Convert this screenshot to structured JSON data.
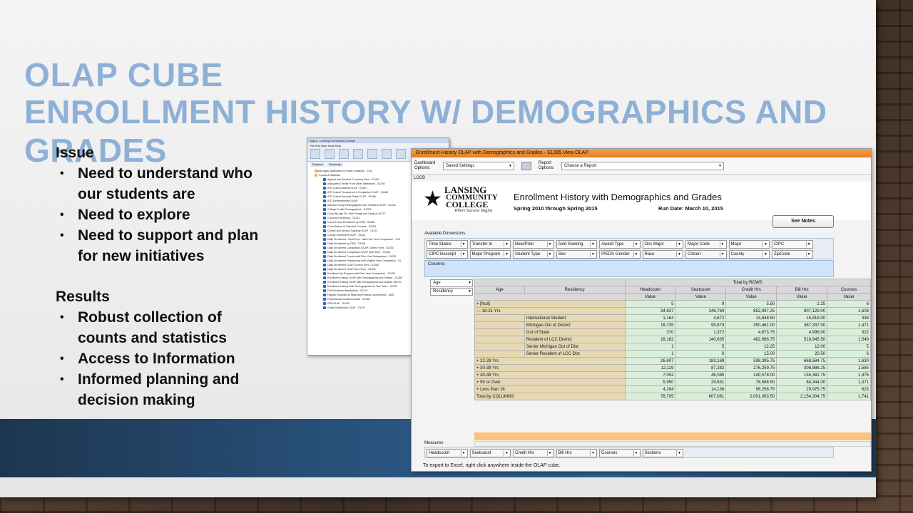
{
  "slide": {
    "title_line1": "OLAP CUBE",
    "title_line2": "ENROLLMENT HISTORY W/ DEMOGRAPHICS AND GRADES",
    "issue_head": "Issue",
    "issue_items": [
      "Need to understand who our students are",
      "Need to explore",
      "Need to support and plan for new initiatives"
    ],
    "results_head": "Results",
    "results_items": [
      "Robust collection of counts and statistics",
      "Access to Information",
      "Informed planning and decision making"
    ]
  },
  "argos": {
    "title": "Argos - Lansing Community College",
    "menu": "File  Edit  View  Tools  Help",
    "tabs": [
      "Explorer",
      "Shortcuts"
    ],
    "path": "Argos.Argos DataBlocks & Folder Locations - 1412",
    "tree": [
      "Counts & Statistics",
      "Applied and Enrolled Counts by Term - S1464",
      "Articulated Credits From Other Institutions - S1294",
      "ATD Cohort Awards OLAP - S1487",
      "ATD Cohort Persistence & Completion OLAP - S1483",
      "ATD Cohort Success Rates OLAP - S1486",
      "ATD Developmental OLAP",
      "Attribute Group Demographics and Transfers OLAP - S1432",
      "College Profile Demographics - S1253",
      "Count By Age For Term Range and Campus S1177",
      "Count by Residency - S1211",
      "Count Future Enrollment by CRN - S1365",
      "Count Takers of Selected Courses - S1284",
      "Course and Section Capacity OLAP - S1471",
      "Course Enrollment OLAP - S1114",
      "Daily Enrollment - Next Term - with Prior Year Comparison - S12",
      "Daily Enrollment by CRN - S1294",
      "Daily Enrollment Comparison OLAP Current Term - S1335",
      "Daily Enrollment Comparison OLAP Next Term - S1335",
      "Daily Enrollment Counts with Prior Year Comparison - S1252",
      "Daily Enrollment Headcounts with Multiple Year Comparison - S1",
      "Daily Enrollment OLAP Current Term - S1284",
      "Daily Enrollment OLAP Next Term - S1284",
      "Enrollment by Program with Prior Year Comparison - S1239",
      "Enrollment History OLAP with Demographics and Grades - S1285",
      "Enrollment History OLAP with Demographics and Grades with Ex",
      "Enrollment History With Demographics for Two Years - S1332",
      "Fall Enrollment Breakdown - S1474",
      "Figures Reported to State and Federal Government - 1405",
      "Financial Aid Student Counts - S1084",
      "GPA OLAP - S1282",
      "Grade Distribution OLAP - S1472"
    ]
  },
  "olap": {
    "window_title": "Enrollment History OLAP with Demographics and Grades - S1285.View OLAP",
    "dashboard_label": "Dashboard Options:",
    "dashboard_value": "Saved Settings",
    "report_label": "Report Options:",
    "report_value": "Choose a Report",
    "lccb": "LCCB",
    "logo": {
      "line1": "LANSING",
      "line2": "COMMUNITY",
      "line3": "COLLEGE",
      "tagline": "Where Success Begins"
    },
    "report_title": "Enrollment History with Demographics and Grades",
    "report_subtitle": "Spring 2010 through Spring 2015",
    "run_date": "Run Date: March 10, 2015",
    "see_notes": "See Notes",
    "available_dimensions": "Available Dimensions",
    "dims_row1": [
      "Time Status",
      "Transfer In",
      "New/Prior",
      "Avid Seeking",
      "Award Type",
      "Occ Major",
      "Major Code",
      "Major",
      "CIPC"
    ],
    "dims_row2": [
      "CIPC Descript",
      "Major Program",
      "Student Type",
      "Sex",
      "IPEDS Gender",
      "Race",
      "Citizen",
      "County",
      "ZipCode"
    ],
    "columns_label": "Columns",
    "row_dims": [
      "Age",
      "Residency"
    ],
    "grid": {
      "total_by_rows": "Total by ROWS",
      "age_hdr": "Age",
      "residency_hdr": "Residency",
      "measures": [
        "Headcount",
        "Seatcount",
        "Credit Hrs",
        "Bill Hrs",
        "Courses"
      ],
      "value_label": "Value",
      "rows": [
        {
          "age": "+ [Null]",
          "res": "",
          "vals": [
            "5",
            "9",
            "5.50",
            "2.25",
            "6"
          ]
        },
        {
          "age": "— 18-21 Yrs",
          "res": "",
          "vals": [
            "34,637",
            "246,769",
            "852,997.25",
            "907,129.00",
            "1,608"
          ]
        },
        {
          "age": "",
          "res": "International Student",
          "vals": [
            "1,164",
            "4,672",
            "14,848.50",
            "15,818.00",
            "438"
          ]
        },
        {
          "age": "",
          "res": "Michigan Out of District",
          "vals": [
            "16,735",
            "99,879",
            "350,461.00",
            "367,337.00",
            "1,471"
          ]
        },
        {
          "age": "",
          "res": "Out of State",
          "vals": [
            "370",
            "1,372",
            "4,673.75",
            "4,996.00",
            "322"
          ]
        },
        {
          "age": "",
          "res": "Resident of LCC District",
          "vals": [
            "18,182",
            "140,835",
            "482,986.75",
            "518,945.50",
            "1,549"
          ]
        },
        {
          "age": "",
          "res": "Senior Michigan Out of Dist",
          "vals": [
            "1",
            "5",
            "12.25",
            "12.00",
            "5"
          ]
        },
        {
          "age": "",
          "res": "Senior Resident of LCC Dist",
          "vals": [
            "1",
            "6",
            "15.00",
            "20.50",
            "6"
          ]
        },
        {
          "age": "+ 22-29 Yrs",
          "res": "",
          "vals": [
            "26,607",
            "183,169",
            "598,395.75",
            "668,584.75",
            "1,630"
          ]
        },
        {
          "age": "+ 30-39 Yrs",
          "res": "",
          "vals": [
            "12,119",
            "87,282",
            "276,259.75",
            "308,886.25",
            "1,585"
          ]
        },
        {
          "age": "+ 40-49 Yrs",
          "res": "",
          "vals": [
            "7,052",
            "46,085",
            "140,578.00",
            "155,382.75",
            "1,476"
          ]
        },
        {
          "age": "+ 50 or Over",
          "res": "",
          "vals": [
            "5,950",
            "29,631",
            "76,568.50",
            "84,344.00",
            "1,371"
          ]
        },
        {
          "age": "+ Less than 18",
          "res": "",
          "vals": [
            "4,284",
            "14,136",
            "56,258.75",
            "29,975.75",
            "623"
          ]
        },
        {
          "age": "Total by COLUMNS",
          "res": "",
          "vals": [
            "78,705",
            "607,081",
            "2,001,063.50",
            "2,154,304.75",
            "1,741"
          ]
        }
      ]
    },
    "measures_label": "Measures",
    "measure_selectors": [
      "Headcount",
      "Seatcount",
      "Credit Hrs",
      "Bill Hrs",
      "Courses",
      "Sections"
    ],
    "footer_note": "To export to Excel, right click anywhere inside the OLAP cube."
  }
}
